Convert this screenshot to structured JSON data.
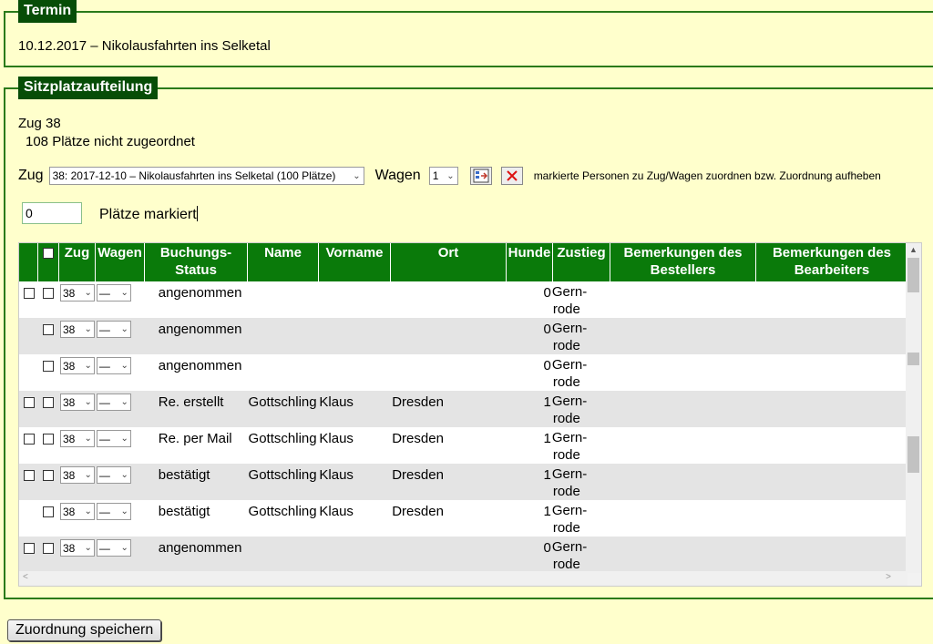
{
  "termin": {
    "legend": "Termin",
    "text": "10.12.2017 – Nikolausfahrten ins Selketal"
  },
  "sitz": {
    "legend": "Sitzplatzaufteilung",
    "zug_line": "Zug 38",
    "plaetze_line": "108 Plätze nicht zugeordnet",
    "zug_label": "Zug",
    "zug_select": "38: 2017-12-10 – Nikolausfahrten ins Selketal (100 Plätze)",
    "wagen_label": "Wagen",
    "wagen_select": "1",
    "hint": "markierte Personen zu Zug/Wagen zuordnen bzw. Zuordnung aufheben",
    "marked_value": "0",
    "marked_label": "Plätze markiert"
  },
  "table": {
    "headers": {
      "zug": "Zug",
      "wagen": "Wagen",
      "status": "Buchungs-\nStatus",
      "name": "Name",
      "vorname": "Vorname",
      "ort": "Ort",
      "hunde": "Hunde",
      "zustieg": "Zustieg",
      "bem_best": "Bemerkungen des\nBestellers",
      "bem_bearb": "Bemerkungen des\nBearbeiters"
    },
    "rows": [
      {
        "cb1": true,
        "zug": "38",
        "wagen": "—",
        "status": "angenommen",
        "name": "",
        "vorname": "",
        "ort": "",
        "hunde": "0",
        "zustieg1": "Gern-",
        "zustieg2": "rode"
      },
      {
        "cb1": false,
        "zug": "38",
        "wagen": "—",
        "status": "angenommen",
        "name": "",
        "vorname": "",
        "ort": "",
        "hunde": "0",
        "zustieg1": "Gern-",
        "zustieg2": "rode"
      },
      {
        "cb1": false,
        "zug": "38",
        "wagen": "—",
        "status": "angenommen",
        "name": "",
        "vorname": "",
        "ort": "",
        "hunde": "0",
        "zustieg1": "Gern-",
        "zustieg2": "rode"
      },
      {
        "cb1": true,
        "zug": "38",
        "wagen": "—",
        "status": "Re. erstellt",
        "name": "Gottschling",
        "vorname": "Klaus",
        "ort": "Dresden",
        "hunde": "1",
        "zustieg1": "Gern-",
        "zustieg2": "rode"
      },
      {
        "cb1": true,
        "zug": "38",
        "wagen": "—",
        "status": "Re. per Mail",
        "name": "Gottschling",
        "vorname": "Klaus",
        "ort": "Dresden",
        "hunde": "1",
        "zustieg1": "Gern-",
        "zustieg2": "rode"
      },
      {
        "cb1": true,
        "zug": "38",
        "wagen": "—",
        "status": "bestätigt",
        "name": "Gottschling",
        "vorname": "Klaus",
        "ort": "Dresden",
        "hunde": "1",
        "zustieg1": "Gern-",
        "zustieg2": "rode"
      },
      {
        "cb1": false,
        "zug": "38",
        "wagen": "—",
        "status": "bestätigt",
        "name": "Gottschling",
        "vorname": "Klaus",
        "ort": "Dresden",
        "hunde": "1",
        "zustieg1": "Gern-",
        "zustieg2": "rode"
      },
      {
        "cb1": true,
        "zug": "38",
        "wagen": "—",
        "status": "angenommen",
        "name": "",
        "vorname": "",
        "ort": "",
        "hunde": "0",
        "zustieg1": "Gern-",
        "zustieg2": "rode"
      }
    ]
  },
  "save_button": "Zuordnung speichern",
  "icons": {
    "assign": "assign-icon",
    "remove": "remove-x-icon"
  },
  "colors": {
    "background": "#ffffcc",
    "header_green": "#0a7a0a",
    "legend_green": "#074d07"
  }
}
